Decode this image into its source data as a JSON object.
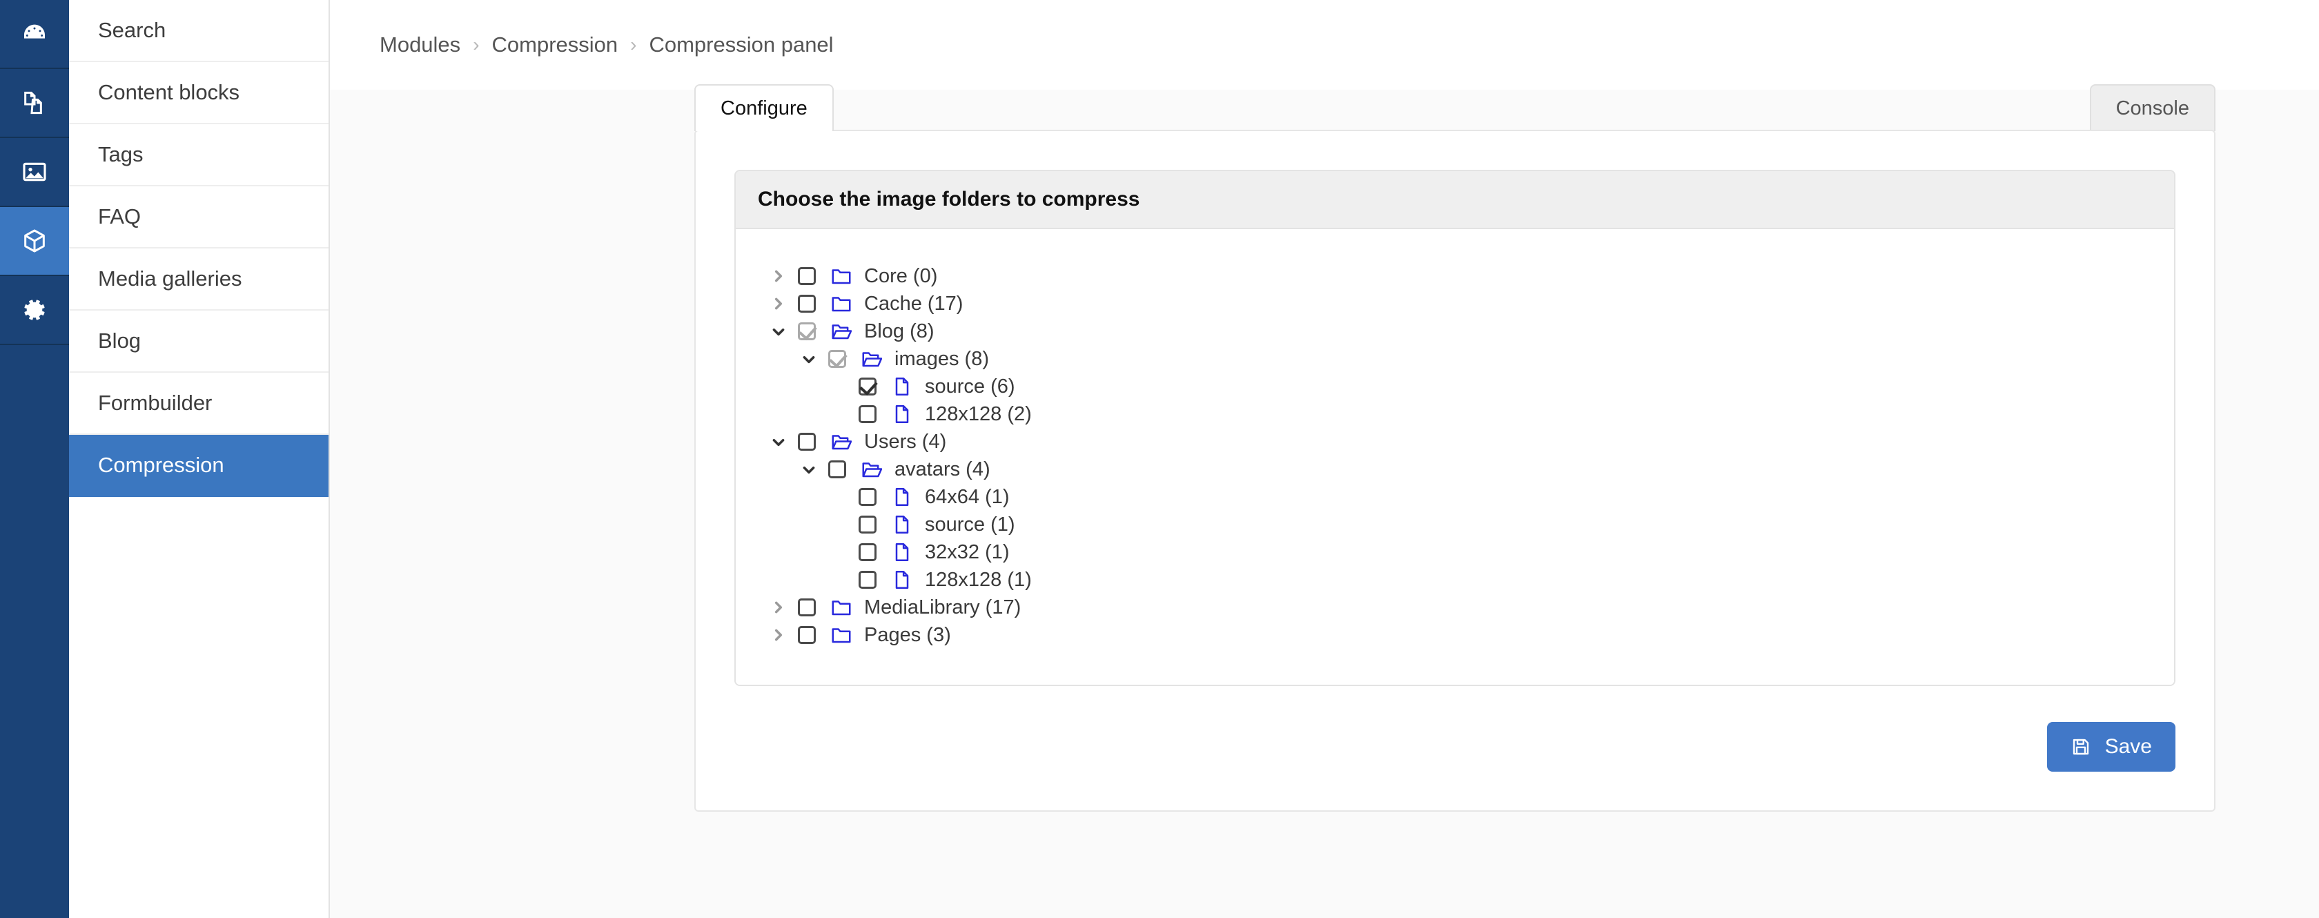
{
  "icon_rail": {
    "items": [
      {
        "icon": "dashboard-gauge-icon",
        "active": false
      },
      {
        "icon": "content-pages-icon",
        "active": false
      },
      {
        "icon": "media-image-icon",
        "active": false
      },
      {
        "icon": "modules-box-icon",
        "active": true
      },
      {
        "icon": "settings-gear-icon",
        "active": false
      }
    ]
  },
  "sidebar": {
    "items": [
      {
        "label": "Search",
        "active": false
      },
      {
        "label": "Content blocks",
        "active": false
      },
      {
        "label": "Tags",
        "active": false
      },
      {
        "label": "FAQ",
        "active": false
      },
      {
        "label": "Media galleries",
        "active": false
      },
      {
        "label": "Blog",
        "active": false
      },
      {
        "label": "Formbuilder",
        "active": false
      },
      {
        "label": "Compression",
        "active": true
      }
    ]
  },
  "breadcrumb": {
    "items": [
      "Modules",
      "Compression",
      "Compression panel"
    ],
    "separator": "›"
  },
  "tabs": [
    {
      "label": "Configure",
      "active": true
    },
    {
      "label": "Console",
      "active": false
    }
  ],
  "panel": {
    "title": "Choose the image folders to compress"
  },
  "tree": {
    "rows": [
      {
        "depth": 0,
        "twisty": "collapsed",
        "check": "unchecked",
        "icon": "folder-closed-icon",
        "label": "Core (0)"
      },
      {
        "depth": 0,
        "twisty": "collapsed",
        "check": "unchecked",
        "icon": "folder-closed-icon",
        "label": "Cache (17)"
      },
      {
        "depth": 0,
        "twisty": "expanded",
        "check": "partial",
        "icon": "folder-open-icon",
        "label": "Blog (8)"
      },
      {
        "depth": 1,
        "twisty": "expanded",
        "check": "partial",
        "icon": "folder-open-icon",
        "label": "images (8)"
      },
      {
        "depth": 2,
        "twisty": "none",
        "check": "checked",
        "icon": "file-icon",
        "label": "source (6)"
      },
      {
        "depth": 2,
        "twisty": "none",
        "check": "unchecked",
        "icon": "file-icon",
        "label": "128x128 (2)"
      },
      {
        "depth": 0,
        "twisty": "expanded",
        "check": "unchecked",
        "icon": "folder-open-icon",
        "label": "Users (4)"
      },
      {
        "depth": 1,
        "twisty": "expanded",
        "check": "unchecked",
        "icon": "folder-open-icon",
        "label": "avatars (4)"
      },
      {
        "depth": 2,
        "twisty": "none",
        "check": "unchecked",
        "icon": "file-icon",
        "label": "64x64 (1)"
      },
      {
        "depth": 2,
        "twisty": "none",
        "check": "unchecked",
        "icon": "file-icon",
        "label": "source (1)"
      },
      {
        "depth": 2,
        "twisty": "none",
        "check": "unchecked",
        "icon": "file-icon",
        "label": "32x32 (1)"
      },
      {
        "depth": 2,
        "twisty": "none",
        "check": "unchecked",
        "icon": "file-icon",
        "label": "128x128 (1)"
      },
      {
        "depth": 0,
        "twisty": "collapsed",
        "check": "unchecked",
        "icon": "folder-closed-icon",
        "label": "MediaLibrary (17)"
      },
      {
        "depth": 0,
        "twisty": "collapsed",
        "check": "unchecked",
        "icon": "folder-closed-icon",
        "label": "Pages (3)"
      }
    ]
  },
  "save_button": {
    "label": "Save",
    "icon": "floppy-save-icon"
  },
  "colors": {
    "rail_bg": "#1b4377",
    "accent_blue": "#3b77c0",
    "save_blue": "#4178c8",
    "folder_blue": "#2929dd",
    "panel_header_bg": "#efefef",
    "page_bg": "#fafafa"
  }
}
